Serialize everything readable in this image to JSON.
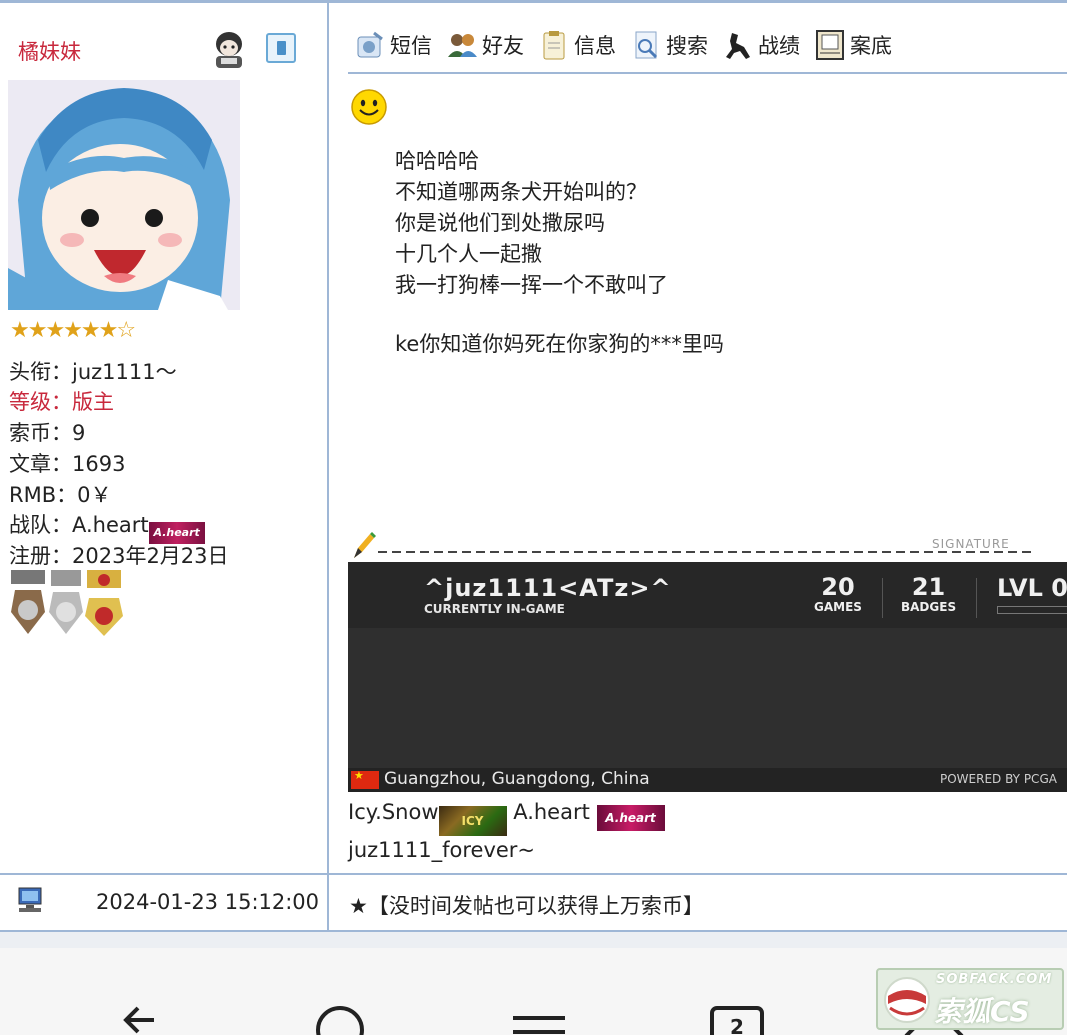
{
  "author": {
    "name": "橘妹妹",
    "stars_filled": 6,
    "stars_total": 7,
    "info": {
      "title_line": "头衔：juz1111～",
      "level_line": "等级：版主",
      "coins_line": "索币：9",
      "posts_line": "文章：1693",
      "rmb_line": "RMB：0￥",
      "team_line": "战队：A.heart",
      "team_badge": "A.heart",
      "register_line": "注册：2023年2月23日"
    }
  },
  "toolbar": {
    "items": [
      {
        "label": "短信",
        "icon": "message-icon"
      },
      {
        "label": "好友",
        "icon": "friends-icon"
      },
      {
        "label": "信息",
        "icon": "info-icon"
      },
      {
        "label": "搜索",
        "icon": "search-icon"
      },
      {
        "label": "战绩",
        "icon": "record-icon"
      },
      {
        "label": "案底",
        "icon": "file-icon"
      }
    ]
  },
  "post": {
    "lines": [
      "哈哈哈哈",
      "不知道哪两条犬开始叫的？",
      "你是说他们到处撒尿吗",
      "十几个人一起撒",
      "我一打狗棒一挥一个不敢叫了"
    ],
    "last_line": "ke你知道你妈死在你家狗的***里吗"
  },
  "signature": {
    "label": "SIGNATURE",
    "game_card": {
      "player": "^juz1111<ATz>^",
      "status": "CURRENTLY IN-GAME",
      "games_value": "20",
      "games_label": "GAMES",
      "badges_value": "21",
      "badges_label": "BADGES",
      "level": "LVL 0",
      "location": "Guangzhou, Guangdong, China",
      "powered": "POWERED BY PCGA"
    },
    "line1_a": "Icy.Snow",
    "line1_badge_a": "ICY",
    "line1_b": " A.heart ",
    "line1_badge_b": "A.heart",
    "line2": "juz1111_forever~"
  },
  "footer": {
    "time": "2024-01-23 15:12:00",
    "ad": "★【没时间发帖也可以获得上万索币】"
  },
  "watermark": {
    "top": "SOBFACK.COM",
    "main": "索狐CS"
  },
  "colors": {
    "name_red": "#c8283c",
    "border_blue": "#9fb7d6",
    "star_gold": "#e0a21a"
  }
}
